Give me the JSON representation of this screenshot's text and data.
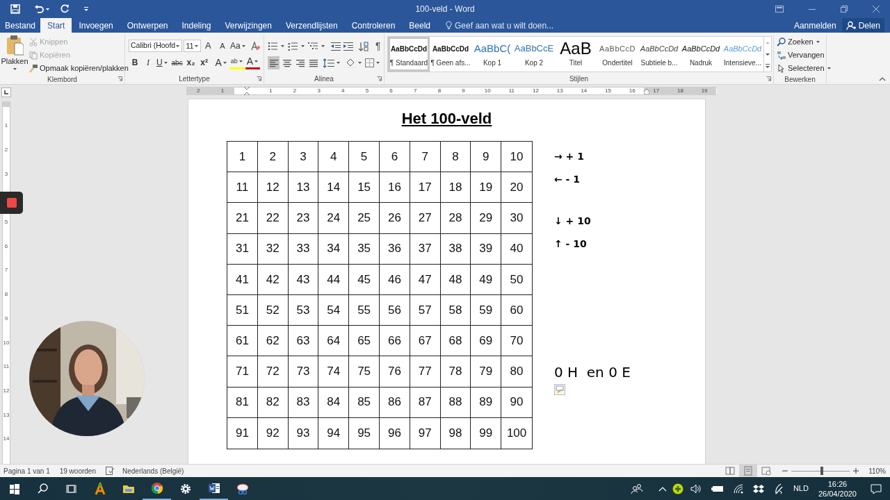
{
  "title_bar": {
    "title": "100-veld - Word"
  },
  "tabs": [
    {
      "label": "Bestand",
      "selected": false
    },
    {
      "label": "Start",
      "selected": true
    },
    {
      "label": "Invoegen",
      "selected": false
    },
    {
      "label": "Ontwerpen",
      "selected": false
    },
    {
      "label": "Indeling",
      "selected": false
    },
    {
      "label": "Verwijzingen",
      "selected": false
    },
    {
      "label": "Verzendlijsten",
      "selected": false
    },
    {
      "label": "Controleren",
      "selected": false
    },
    {
      "label": "Beeld",
      "selected": false
    }
  ],
  "tell_me": {
    "placeholder": "Geef aan wat u wilt doen..."
  },
  "account": {
    "sign_in": "Aanmelden",
    "share": "Delen"
  },
  "clipboard": {
    "paste": "Plakken",
    "cut": {
      "label": "Knippen",
      "disabled": true
    },
    "copy": {
      "label": "Kopiëren",
      "disabled": true
    },
    "format_painter": {
      "label": "Opmaak kopiëren/plakken",
      "disabled": false
    },
    "group_label": "Klembord"
  },
  "font": {
    "name": "Calibri (Hoofd",
    "size": "11",
    "grow": "A",
    "shrink": "A",
    "change_case": "Aa",
    "bold": "B",
    "italic": "I",
    "underline": "U",
    "strikethrough": "abc",
    "subscript": "x₂",
    "superscript": "x²",
    "text_effects": "A",
    "highlight": "ab",
    "font_color": "A",
    "group_label": "Lettertype"
  },
  "paragraph": {
    "pilcrow": "¶",
    "alignments": [
      {
        "kind": "left",
        "selected": true
      },
      {
        "kind": "center",
        "selected": false
      },
      {
        "kind": "right",
        "selected": false
      },
      {
        "kind": "justify",
        "selected": false
      }
    ],
    "group_label": "Alinea"
  },
  "styles": {
    "items": [
      {
        "preview": "AaBbCcDd",
        "label": "¶ Standaard",
        "kind": "normal",
        "selected": true
      },
      {
        "preview": "AaBbCcDd",
        "label": "¶ Geen afs...",
        "kind": "no_spacing",
        "selected": false
      },
      {
        "preview": "AaBbC(",
        "label": "Kop 1",
        "kind": "heading1",
        "selected": false
      },
      {
        "preview": "AaBbCcE",
        "label": "Kop 2",
        "kind": "heading2",
        "selected": false
      },
      {
        "preview": "AaB",
        "label": "Titel",
        "kind": "title",
        "selected": false
      },
      {
        "preview": "AaBbCcD",
        "label": "Ondertitel",
        "kind": "subtitle",
        "selected": false
      },
      {
        "preview": "AaBbCcDd",
        "label": "Subtiele b...",
        "kind": "subtle_emphasis",
        "selected": false
      },
      {
        "preview": "AaBbCcDd",
        "label": "Nadruk",
        "kind": "emphasis",
        "selected": false
      },
      {
        "preview": "AaBbCcDd",
        "label": "Intensieve...",
        "kind": "intense_emphasis",
        "selected": false
      }
    ],
    "group_label": "Stijlen"
  },
  "editing": {
    "find": "Zoeken",
    "replace": "Vervangen",
    "select": "Selecteren",
    "group_label": "Bewerken"
  },
  "horizontal_ruler": [
    "2",
    "1",
    "1",
    "2",
    "3",
    "4",
    "5",
    "6",
    "7",
    "8",
    "9",
    "10",
    "11",
    "12",
    "13",
    "14",
    "15",
    "16",
    "17",
    "18",
    "19"
  ],
  "vertical_ruler": [
    "1",
    "2",
    "3",
    "5",
    "6",
    "7",
    "8",
    "9",
    "10",
    "11",
    "12",
    "13",
    "14"
  ],
  "document": {
    "title": "Het 100-veld",
    "grid_rows": [
      {
        "cells": [
          "1",
          "2",
          "3",
          "4",
          "5",
          "6",
          "7",
          "8",
          "9",
          "10"
        ]
      },
      {
        "cells": [
          "11",
          "12",
          "13",
          "14",
          "15",
          "16",
          "17",
          "18",
          "19",
          "20"
        ]
      },
      {
        "cells": [
          "21",
          "22",
          "23",
          "24",
          "25",
          "26",
          "27",
          "28",
          "29",
          "30"
        ]
      },
      {
        "cells": [
          "31",
          "32",
          "33",
          "34",
          "35",
          "36",
          "37",
          "38",
          "39",
          "40"
        ]
      },
      {
        "cells": [
          "41",
          "42",
          "43",
          "44",
          "45",
          "46",
          "47",
          "48",
          "49",
          "50"
        ]
      },
      {
        "cells": [
          "51",
          "52",
          "53",
          "54",
          "55",
          "56",
          "57",
          "58",
          "59",
          "60"
        ]
      },
      {
        "cells": [
          "61",
          "62",
          "63",
          "64",
          "65",
          "66",
          "67",
          "68",
          "69",
          "70"
        ]
      },
      {
        "cells": [
          "71",
          "72",
          "73",
          "74",
          "75",
          "76",
          "77",
          "78",
          "79",
          "80"
        ]
      },
      {
        "cells": [
          "81",
          "82",
          "83",
          "84",
          "85",
          "86",
          "87",
          "88",
          "89",
          "90"
        ]
      },
      {
        "cells": [
          "91",
          "92",
          "93",
          "94",
          "95",
          "96",
          "97",
          "98",
          "99",
          "100"
        ]
      }
    ],
    "moves": [
      "→ + 1",
      "← - 1",
      "↓ + 10",
      "↑ - 10"
    ],
    "answer": "0 H  en 0 E"
  },
  "status_bar": {
    "page": "Pagina 1 van 1",
    "words": "19 woorden",
    "language": "Nederlands (België)",
    "views": [
      {
        "kind": "read",
        "selected": false
      },
      {
        "kind": "print",
        "selected": true
      },
      {
        "kind": "web",
        "selected": false
      }
    ],
    "zoom": {
      "level": 0.52,
      "reading": "110%"
    }
  },
  "taskbar": {
    "items": [
      {
        "kind": "start",
        "active": false
      },
      {
        "kind": "search",
        "active": false
      },
      {
        "kind": "task_view",
        "active": false
      },
      {
        "kind": "app_a",
        "active": false
      },
      {
        "kind": "explorer",
        "active": false
      },
      {
        "kind": "browser",
        "active": true
      },
      {
        "kind": "settings",
        "active": false
      },
      {
        "kind": "word",
        "active": true
      },
      {
        "kind": "snip",
        "active": false
      }
    ],
    "language": "NLD",
    "time": "16:26",
    "date": "26/04/2020"
  }
}
